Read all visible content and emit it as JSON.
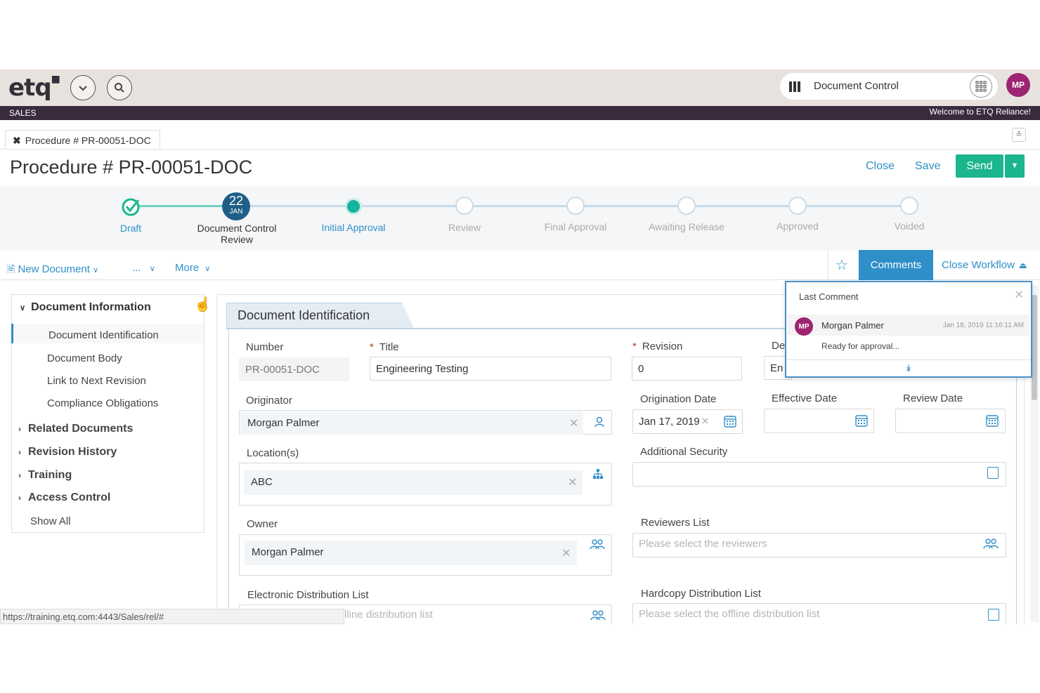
{
  "header": {
    "logo": "etq",
    "app_name": "Document Control",
    "user_initials": "MP",
    "section": "SALES",
    "welcome": "Welcome to ETQ Reliance!"
  },
  "tab": {
    "label": "Procedure # PR-00051-DOC"
  },
  "page": {
    "title": "Procedure # PR-00051-DOC",
    "close_label": "Close",
    "save_label": "Save",
    "send_label": "Send"
  },
  "workflow": {
    "current_day": "22",
    "current_month": "JAN",
    "steps": [
      "Draft",
      "Document Control Review",
      "Initial Approval",
      "Review",
      "Final Approval",
      "Awaiting Release",
      "Approved",
      "Voided"
    ]
  },
  "toolbar": {
    "new_document": "New Document",
    "ellipsis": "...",
    "more": "More",
    "comments": "Comments",
    "close_workflow": "Close Workflow"
  },
  "nav": {
    "section": "Document Information",
    "sub_items": [
      "Document Identification",
      "Document Body",
      "Link to Next Revision",
      "Compliance Obligations"
    ],
    "groups": [
      "Related Documents",
      "Revision History",
      "Training",
      "Access Control"
    ],
    "show_all": "Show All"
  },
  "form": {
    "section_title": "Document Identification",
    "number_label": "Number",
    "number_value": "PR-00051-DOC",
    "title_label": "Title",
    "title_value": "Engineering Testing",
    "revision_label": "Revision",
    "revision_value": "0",
    "de_label": "De",
    "en_value": "En",
    "originator_label": "Originator",
    "originator_value": "Morgan Palmer",
    "origination_date_label": "Origination Date",
    "origination_date_value": "Jan 17, 2019",
    "effective_date_label": "Effective Date",
    "review_date_label": "Review Date",
    "locations_label": "Location(s)",
    "location_value": "ABC",
    "additional_security_label": "Additional Security",
    "owner_label": "Owner",
    "owner_value": "Morgan Palmer",
    "reviewers_label": "Reviewers List",
    "reviewers_placeholder": "Please select the reviewers",
    "electronic_dist_label": "Electronic Distribution List",
    "electronic_dist_partial": "lline distribution list",
    "hardcopy_dist_label": "Hardcopy Distribution List",
    "hardcopy_placeholder": "Please select the offline distribution list"
  },
  "comment_popup": {
    "title": "Last Comment",
    "initials": "MP",
    "author": "Morgan Palmer",
    "date": "Jan 18, 2019 11:16:11 AM",
    "text": "Ready for approval..."
  },
  "status_url": "https://training.etq.com:4443/Sales/rel/#",
  "colors": {
    "accent": "#2f8fc8",
    "send": "#1bb58e",
    "brand": "#3a2a3e",
    "avatar": "#9c2470"
  }
}
